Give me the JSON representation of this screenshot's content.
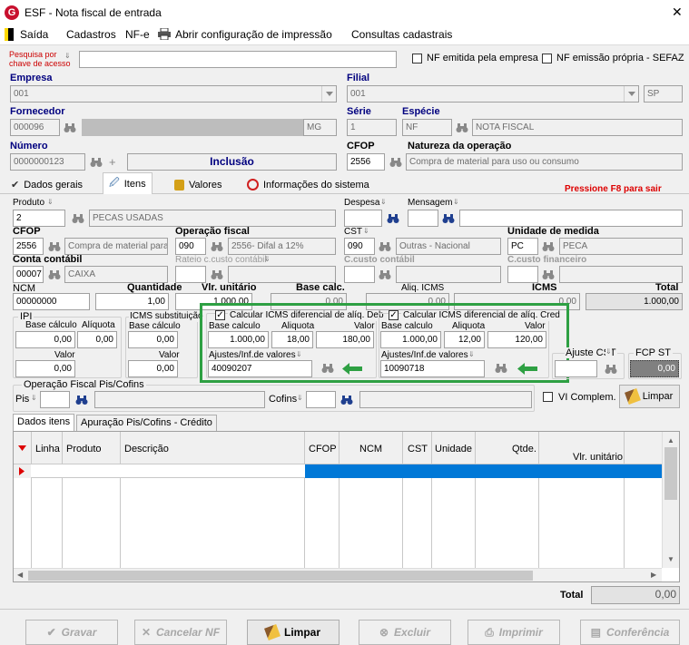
{
  "window": {
    "title": "ESF - Nota fiscal de entrada",
    "close": "✕"
  },
  "menu": {
    "saida": "Saída",
    "cadastros": "Cadastros",
    "nfe": "NF-e",
    "print_config": "Abrir configuração de impressão",
    "consultas": "Consultas cadastrais"
  },
  "search": {
    "label_line1": "Pesquisa por",
    "label_line2": "chave de acesso",
    "value": "",
    "nf_empresa": "NF emitida pela empresa",
    "nf_sefaz": "NF emissão própria - SEFAZ"
  },
  "empresa": {
    "label": "Empresa",
    "value": "001"
  },
  "filial": {
    "label": "Filial",
    "value": "001",
    "uf": "SP"
  },
  "fornecedor": {
    "label": "Fornecedor",
    "code": "000096",
    "uf": "MG"
  },
  "serie": {
    "label": "Série",
    "value": "1"
  },
  "especie": {
    "label": "Espécie",
    "code": "NF",
    "desc": "NOTA FISCAL"
  },
  "numero": {
    "label": "Número",
    "value": "0000000123",
    "status": "Inclusão"
  },
  "cfop_top": {
    "label": "CFOP",
    "value": "2556"
  },
  "natureza": {
    "label": "Natureza da operação",
    "value": "Compra de material para uso ou consumo"
  },
  "tabs": {
    "dados_gerais": "Dados gerais",
    "itens": "Itens",
    "valores": "Valores",
    "info_sistema": "Informações do sistema",
    "hint": "Pressione F8 para sair"
  },
  "item": {
    "produto_label": "Produto",
    "produto_code": "2",
    "produto_desc": "PECAS USADAS",
    "despesa_label": "Despesa",
    "mensagem_label": "Mensagem",
    "cfop_label": "CFOP",
    "cfop_value": "2556",
    "cfop_desc": "Compra de material para u",
    "op_fiscal_label": "Operação fiscal",
    "op_fiscal_code": "090",
    "op_fiscal_desc": "2556- Difal a 12%",
    "cst_label": "CST",
    "cst_code": "090",
    "cst_desc": "Outras - Nacional",
    "unidade_label": "Unidade de medida",
    "unidade_code": "PC",
    "unidade_desc": "PECA",
    "conta_label": "Conta contábil",
    "conta_code": "00007",
    "conta_desc": "CAIXA",
    "rateio_label": "Rateio c.custo contábil",
    "ccusto_label": "C.custo contábil",
    "ccusto_fin_label": "C.custo financeiro",
    "ncm_label": "NCM",
    "ncm_value": "00000000",
    "quantidade_label": "Quantidade",
    "quantidade_value": "1,00",
    "vlr_unit_label": "Vlr. unitário",
    "vlr_unit_value": "1.000,00",
    "base_calc_label": "Base calc.",
    "base_calc_value": "0,00",
    "aliq_icms_label": "Aliq. ICMS",
    "aliq_icms_value": "0,00",
    "icms_label": "ICMS",
    "icms_value": "0,00",
    "total_label": "Total",
    "total_value": "1.000,00"
  },
  "ipi": {
    "title": "IPI",
    "base_label": "Base cálculo",
    "base_value": "0,00",
    "aliq_label": "Alíquota",
    "aliq_value": "0,00",
    "valor_label": "Valor",
    "valor_value": "0,00"
  },
  "icms_st": {
    "title": "ICMS substituição",
    "base_label": "Base cálculo",
    "base_value": "0,00",
    "valor_label": "Valor",
    "valor_value": "0,00"
  },
  "difal_deb": {
    "title": "Calcular ICMS diferencial de alíq. Deb",
    "base_label": "Base calculo",
    "base_value": "1.000,00",
    "aliq_label": "Aliquota",
    "aliq_value": "18,00",
    "valor_label": "Valor",
    "valor_value": "180,00",
    "ajustes_label": "Ajustes/Inf.de valores",
    "ajustes_value": "40090207"
  },
  "difal_cred": {
    "title": "Calcular ICMS diferencial de alíq. Cred",
    "base_label": "Base calculo",
    "base_value": "1.000,00",
    "aliq_label": "Aliquota",
    "aliq_value": "12,00",
    "valor_label": "Valor",
    "valor_value": "120,00",
    "ajustes_label": "Ajustes/Inf.de valores",
    "ajustes_value": "10090718"
  },
  "ajuste_cst": {
    "label": "Ajuste CST",
    "fcp_label": "FCP ST",
    "fcp_value": "0,00"
  },
  "pis_cofins": {
    "title": "Operação Fiscal Pis/Cofins",
    "pis_label": "Pis",
    "cofins_label": "Cofins",
    "vl_complem": "VI Complem.",
    "limpar": "Limpar"
  },
  "grid": {
    "tab1": "Dados itens",
    "tab2": "Apuração Pis/Cofins - Crédito",
    "cols": [
      "Linha",
      "Produto",
      "Descrição",
      "CFOP",
      "NCM",
      "CST",
      "Unidade",
      "Qtde.",
      "Vlr. unitário"
    ],
    "total_label": "Total",
    "total_value": "0,00"
  },
  "buttons": {
    "gravar": "Gravar",
    "cancelar": "Cancelar NF",
    "limpar": "Limpar",
    "excluir": "Excluir",
    "imprimir": "Imprimir",
    "conferencia": "Conferência"
  }
}
